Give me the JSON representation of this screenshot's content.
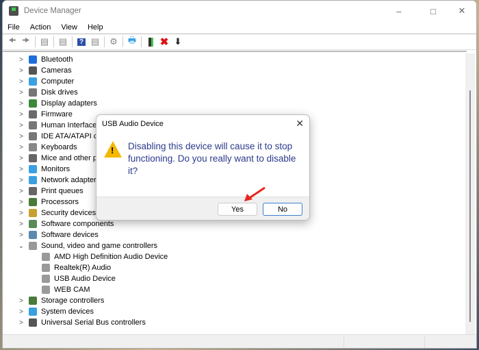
{
  "window": {
    "title": "Device Manager",
    "controls": [
      "minimize",
      "maximize",
      "close"
    ]
  },
  "menu": [
    "File",
    "Action",
    "View",
    "Help"
  ],
  "toolbar": [
    "back-icon",
    "forward-icon",
    "show-hide-console-tree-icon",
    "properties-icon",
    "help-icon",
    "action-pane-icon",
    "scan-hardware-icon",
    "monitor-icon",
    "update-driver-icon",
    "uninstall-icon",
    "disable-device-icon"
  ],
  "tree": {
    "categories": [
      {
        "label": "Bluetooth",
        "color": "#1e6fd9"
      },
      {
        "label": "Cameras",
        "color": "#555555"
      },
      {
        "label": "Computer",
        "color": "#3aa0e0"
      },
      {
        "label": "Disk drives",
        "color": "#777777"
      },
      {
        "label": "Display adapters",
        "color": "#3a8a3a"
      },
      {
        "label": "Firmware",
        "color": "#6b6b6b"
      },
      {
        "label": "Human Interface Devices",
        "color": "#777777"
      },
      {
        "label": "IDE ATA/ATAPI controllers",
        "color": "#777777"
      },
      {
        "label": "Keyboards",
        "color": "#888888"
      },
      {
        "label": "Mice and other pointing devices",
        "color": "#666666"
      },
      {
        "label": "Monitors",
        "color": "#3aa0e0"
      },
      {
        "label": "Network adapters",
        "color": "#3aa0e0"
      },
      {
        "label": "Print queues",
        "color": "#666666"
      },
      {
        "label": "Processors",
        "color": "#4a7a3a"
      },
      {
        "label": "Security devices",
        "color": "#c8a030"
      },
      {
        "label": "Software components",
        "color": "#5a8a5a"
      },
      {
        "label": "Software devices",
        "color": "#5a8ab0"
      },
      {
        "label": "Sound, video and game controllers",
        "color": "#999999",
        "expanded": true,
        "children": [
          "AMD High Definition Audio Device",
          "Realtek(R) Audio",
          "USB Audio Device",
          "WEB CAM"
        ]
      },
      {
        "label": "Storage controllers",
        "color": "#4a7a3a"
      },
      {
        "label": "System devices",
        "color": "#3aa0e0"
      },
      {
        "label": "Universal Serial Bus controllers",
        "color": "#555555"
      }
    ]
  },
  "dialog": {
    "title": "USB Audio Device",
    "message": "Disabling this device will cause it to stop functioning. Do you really want to disable it?",
    "yes": "Yes",
    "no": "No",
    "warning_color": "#f5b800",
    "annotation_arrow_color": "#e8241c"
  }
}
